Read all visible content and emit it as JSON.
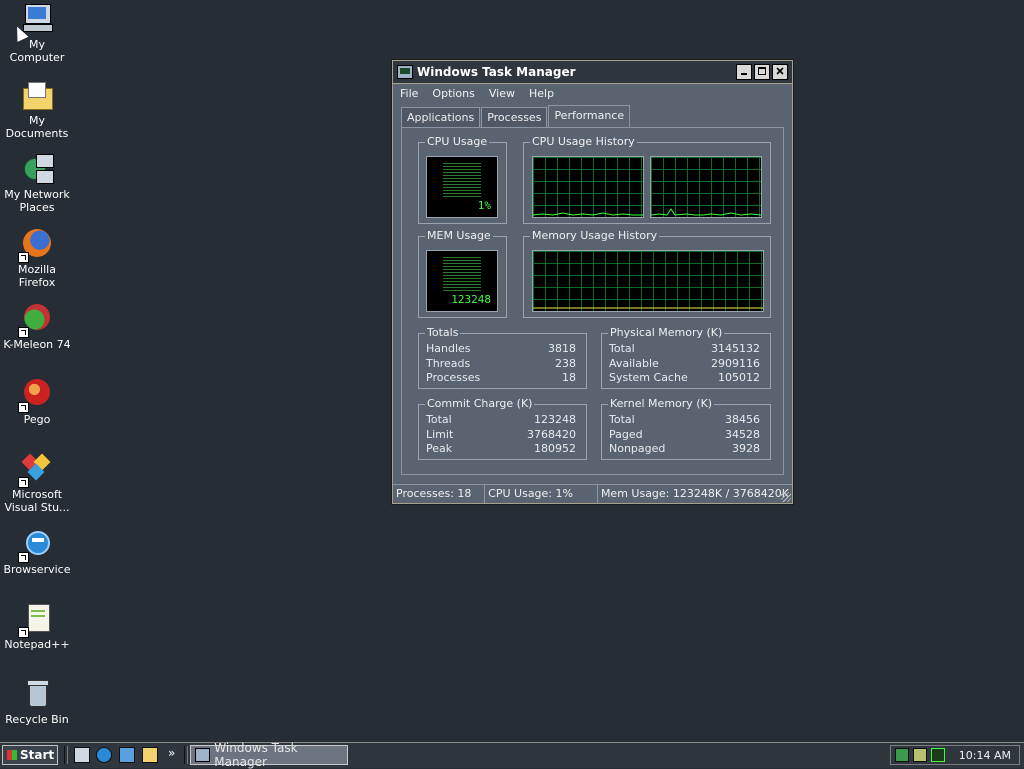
{
  "desktop": {
    "icons": [
      {
        "label": "My Computer"
      },
      {
        "label": "My Documents"
      },
      {
        "label": "My Network Places"
      },
      {
        "label": "Mozilla Firefox"
      },
      {
        "label": "K-Meleon 74"
      },
      {
        "label": "Pego"
      },
      {
        "label": "Microsoft Visual Stu..."
      },
      {
        "label": "Browservice"
      },
      {
        "label": "Notepad++"
      },
      {
        "label": "Recycle Bin"
      }
    ]
  },
  "window": {
    "title": "Windows Task Manager",
    "menu": [
      "File",
      "Options",
      "View",
      "Help"
    ],
    "tabs": [
      "Applications",
      "Processes",
      "Performance"
    ],
    "active_tab": "Performance",
    "cpu_usage": {
      "label": "CPU Usage",
      "value": "1%"
    },
    "cpu_history": {
      "label": "CPU Usage History"
    },
    "mem_usage": {
      "label": "MEM Usage",
      "value": "123248"
    },
    "mem_history": {
      "label": "Memory Usage History"
    },
    "totals": {
      "label": "Totals",
      "rows": [
        {
          "name": "Handles",
          "value": "3818"
        },
        {
          "name": "Threads",
          "value": "238"
        },
        {
          "name": "Processes",
          "value": "18"
        }
      ]
    },
    "physical": {
      "label": "Physical Memory (K)",
      "rows": [
        {
          "name": "Total",
          "value": "3145132"
        },
        {
          "name": "Available",
          "value": "2909116"
        },
        {
          "name": "System Cache",
          "value": "105012"
        }
      ]
    },
    "commit": {
      "label": "Commit Charge (K)",
      "rows": [
        {
          "name": "Total",
          "value": "123248"
        },
        {
          "name": "Limit",
          "value": "3768420"
        },
        {
          "name": "Peak",
          "value": "180952"
        }
      ]
    },
    "kernel": {
      "label": "Kernel Memory (K)",
      "rows": [
        {
          "name": "Total",
          "value": "38456"
        },
        {
          "name": "Paged",
          "value": "34528"
        },
        {
          "name": "Nonpaged",
          "value": "3928"
        }
      ]
    },
    "status": {
      "processes": "Processes: 18",
      "cpu": "CPU Usage: 1%",
      "mem": "Mem Usage: 123248K / 3768420K"
    }
  },
  "taskbar": {
    "start_label": "Start",
    "overflow": "»",
    "task_title": "Windows Task Manager",
    "clock": "10:14 AM"
  },
  "icons": {
    "my_computer": "computer-icon",
    "documents": "folder-icon",
    "network": "network-icon",
    "firefox": "firefox-icon",
    "kmeleon": "kmeleon-icon",
    "pego": "pego-icon",
    "vs": "visual-studio-icon",
    "ie": "browser-icon",
    "notepad": "notepad-icon",
    "recycle": "recycle-bin-icon"
  },
  "colors": {
    "desktop": "#272d34",
    "window": "#5a6370",
    "graph_green": "#3cff3c",
    "grid": "#0b6d2a"
  }
}
